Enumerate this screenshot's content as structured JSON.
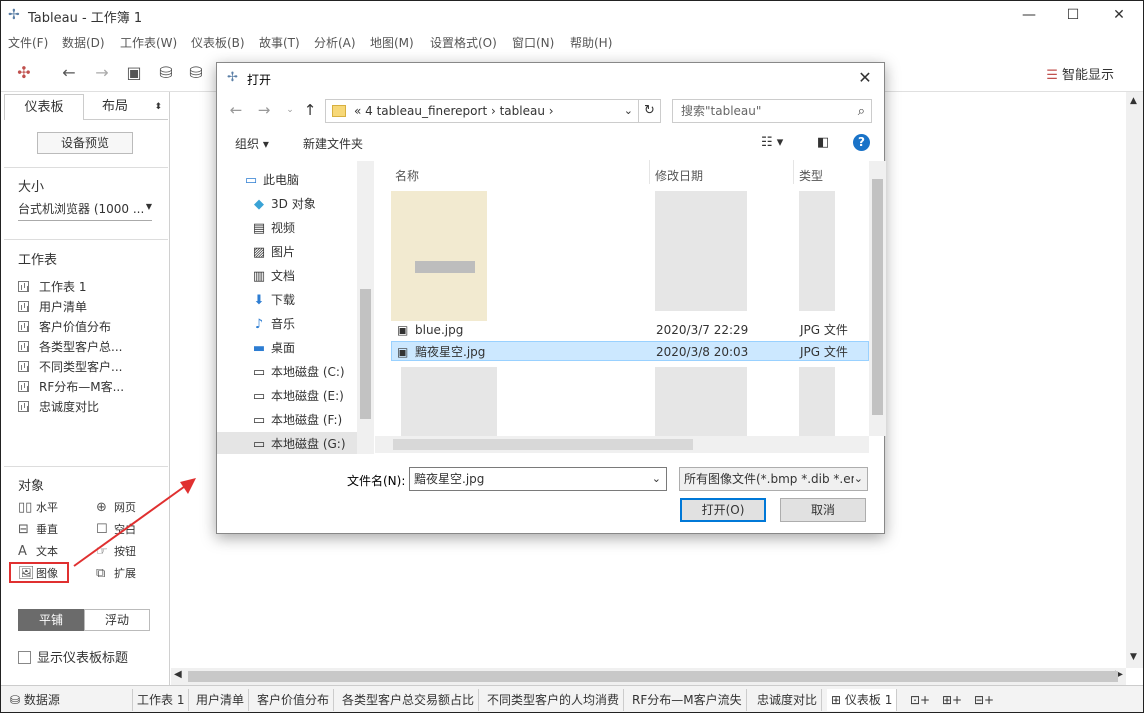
{
  "window": {
    "title": "Tableau - 工作簿 1",
    "logo_icon": "tableau-logo-icon",
    "controls": [
      "—",
      "☐",
      "✕"
    ]
  },
  "menu": [
    "文件(F)",
    "数据(D)",
    "工作表(W)",
    "仪表板(B)",
    "故事(T)",
    "分析(A)",
    "地图(M)",
    "设置格式(O)",
    "窗口(N)",
    "帮助(H)"
  ],
  "toolbar": {
    "smart_show": "智能显示"
  },
  "left_panel": {
    "tab_dashboard": "仪表板",
    "tab_layout": "布局",
    "device_preview": "设备预览",
    "size_label": "大小",
    "size_value": "台式机浏览器 (1000 ...",
    "sheets_label": "工作表",
    "sheets": [
      "工作表 1",
      "用户清单",
      "客户价值分布",
      "各类型客户总...",
      "不同类型客户...",
      "RF分布—M客...",
      "忠诚度对比"
    ],
    "objects_label": "对象",
    "objects": [
      {
        "label": "水平",
        "icon": "horizontal-icon"
      },
      {
        "label": "网页",
        "icon": "globe-icon"
      },
      {
        "label": "垂直",
        "icon": "vertical-icon"
      },
      {
        "label": "空白",
        "icon": "blank-icon"
      },
      {
        "label": "文本",
        "icon": "text-icon"
      },
      {
        "label": "按钮",
        "icon": "button-icon"
      },
      {
        "label": "图像",
        "icon": "image-icon"
      },
      {
        "label": "扩展",
        "icon": "extension-icon"
      }
    ],
    "tiled": "平铺",
    "floating": "浮动",
    "show_title": "显示仪表板标题"
  },
  "bottom_tabs": {
    "data_source": "数据源",
    "tabs": [
      "工作表 1",
      "用户清单",
      "客户价值分布",
      "各类型客户总交易额占比",
      "不同类型客户的人均消费",
      "RF分布—M客户流失",
      "忠诚度对比",
      "仪表板 1"
    ]
  },
  "dialog": {
    "title": "打开",
    "address": "«  4 tableau_finereport  ›  tableau  ›",
    "search_placeholder": "搜索\"tableau\"",
    "organize": "组织 ▾",
    "new_folder": "新建文件夹",
    "nav_items": [
      {
        "label": "此电脑",
        "icon": "computer-icon"
      },
      {
        "label": "3D 对象",
        "icon": "cube-icon"
      },
      {
        "label": "视频",
        "icon": "video-icon"
      },
      {
        "label": "图片",
        "icon": "picture-icon"
      },
      {
        "label": "文档",
        "icon": "document-icon"
      },
      {
        "label": "下载",
        "icon": "download-icon"
      },
      {
        "label": "音乐",
        "icon": "music-icon"
      },
      {
        "label": "桌面",
        "icon": "desktop-icon"
      },
      {
        "label": "本地磁盘 (C:)",
        "icon": "drive-icon"
      },
      {
        "label": "本地磁盘 (E:)",
        "icon": "drive-icon"
      },
      {
        "label": "本地磁盘 (F:)",
        "icon": "drive-icon"
      },
      {
        "label": "本地磁盘 (G:)",
        "icon": "drive-icon"
      }
    ],
    "columns": {
      "name": "名称",
      "modified": "修改日期",
      "type": "类型"
    },
    "files": [
      {
        "name": "blue.jpg",
        "modified": "2020/3/7 22:29",
        "type": "JPG 文件"
      },
      {
        "name": "黯夜星空.jpg",
        "modified": "2020/3/8 20:03",
        "type": "JPG 文件"
      }
    ],
    "filename_label": "文件名(N):",
    "filename_value": "黯夜星空.jpg",
    "filter_value": "所有图像文件(*.bmp *.dib *.er",
    "open_button": "打开(O)",
    "cancel_button": "取消"
  },
  "annotation_color": "#e03030"
}
